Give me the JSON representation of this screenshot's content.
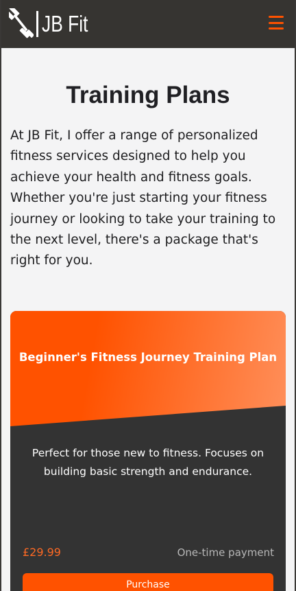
{
  "header": {
    "logo_text": "JB Fit",
    "logo_icon": "dumbbell-icon",
    "menu_icon": "hamburger-menu-icon"
  },
  "page": {
    "title": "Training Plans",
    "intro": "At JB Fit, I offer a range of personalized fitness services designed to help you achieve your health and fitness goals. Whether you're just starting your fitness journey or looking to take your training to the next level, there's a package that's right for you."
  },
  "plans": [
    {
      "title": "Beginner's Fitness Journey Training Plan",
      "description": "Perfect for those new to fitness. Focuses on building basic strength and endurance.",
      "price": "£29.99",
      "payment_type": "One-time payment",
      "button_label": "Purchase"
    }
  ],
  "colors": {
    "header_bg": "#363431",
    "page_bg": "#f4f4f5",
    "accent": "#ff5200",
    "accent_light": "#ff8f5a",
    "card_bg": "#333333",
    "price": "#ff6a24"
  }
}
